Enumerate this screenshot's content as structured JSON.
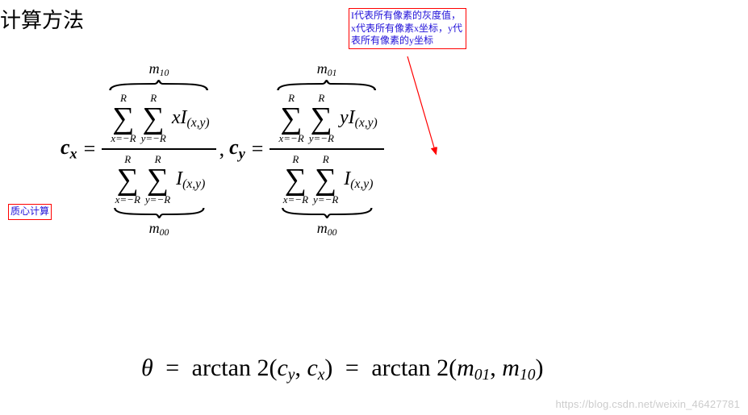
{
  "title": "计算方法",
  "labels": {
    "centroid": "质心计算",
    "note": "I代表所有像素的灰度值，x代表所有像素x坐标，y代表所有像素的y坐标"
  },
  "watermark": "https://blog.csdn.net/weixin_46427781",
  "math": {
    "cx_lhs": "c",
    "cx_sub": "x",
    "cy_lhs": "c",
    "cy_sub": "y",
    "eq": "=",
    "comma": ",",
    "m10": "m",
    "m10_sub": "10",
    "m01": "m",
    "m01_sub": "01",
    "m00": "m",
    "m00_sub": "00",
    "sum_top": "R",
    "sum_bot_x": "x=−R",
    "sum_bot_y": "y=−R",
    "term_xI": "xI",
    "term_yI": "yI",
    "term_I": "I",
    "I_sub": "(x,y)",
    "theta": "θ",
    "arctan2": "arctan 2",
    "paren_open": "(",
    "paren_close": ")"
  }
}
